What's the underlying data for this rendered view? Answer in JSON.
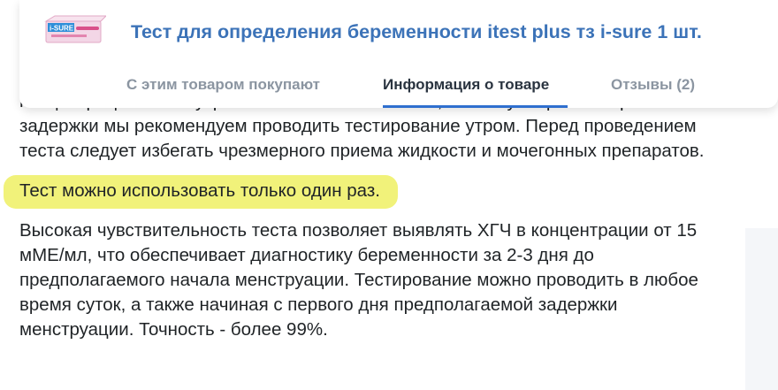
{
  "header": {
    "product_title": "Тест для определения беременности itest plus тз i-sure 1 шт.",
    "thumbnail": {
      "icon": "product-box-thumbnail",
      "brand_text": "i-SURE",
      "colors": {
        "box": "#f3d6e6",
        "box_dark": "#d94f8a",
        "badge": "#2f8fd9"
      }
    },
    "tabs": [
      {
        "label": "С этим товаром покупают",
        "active": false
      },
      {
        "label": "Информация о товаре",
        "active": true
      },
      {
        "label": "Отзывы (2)",
        "active": false
      }
    ]
  },
  "content": {
    "paragraph_1": "концентрация ХГЧ в утренней моче максимальна, поэтому на ранних сроках задержки мы рекомендуем проводить тестирование утром. Перед проведением теста следует избегать чрезмерного приема жидкости и мочегонных препаратов.",
    "highlighted": "Тест можно использовать только один раз.",
    "paragraph_2": "Высокая чувствительность теста позволяет выявлять ХГЧ в концентрации от 15 мМЕ/мл, что обеспечивает диагностику беременности за 2-3 дня до предполагаемого начала менструации. Тестирование можно проводить в любое время суток, а также начиная с первого дня предполагаемой задержки менструации. Точность - более 99%."
  },
  "colors": {
    "title": "#3c73b8",
    "active_tab": "#2a3440",
    "inactive_tab": "#8b95a1",
    "tab_underline": "#2f6fcf",
    "highlight": "#f1f27a"
  }
}
